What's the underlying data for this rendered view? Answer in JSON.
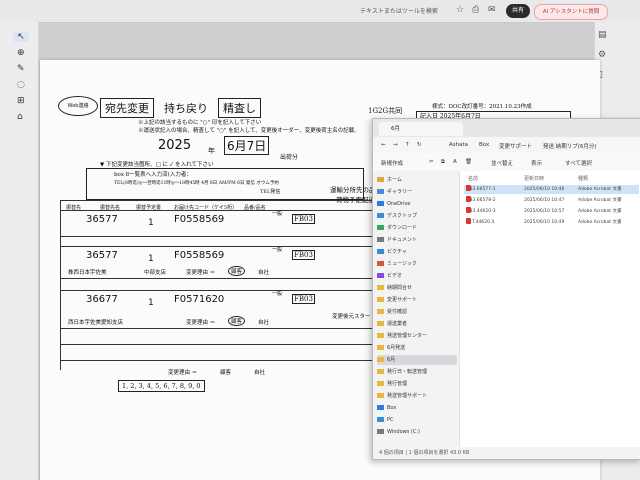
{
  "viewer": {
    "search_placeholder": "テキストまたはツールを検索",
    "share_label": "共有",
    "ai_label": "AI アシスタントに質問"
  },
  "document": {
    "stamp_text": "Web連絡",
    "tag_change": "宛先変更",
    "tag_return": "持ち戻り",
    "tag_confirm": "精査し",
    "instruction_1": "※上記の該当するものに \"○\" 印を記入して下さい",
    "instruction_2": "※運送状記入の場合、精査して \"○\" を記入して、変更後オーダー、変更後荷主名の記載、",
    "year_value": "2025",
    "year_label": "年",
    "date_value": "6月7日",
    "time_value": "出荷分",
    "code_label": "1G2G共同",
    "doc_meta_1": "様式：DOC改訂番号：2021.10.23作成",
    "doc_meta_2": "記入日 2025年6月7日",
    "fill_note": "▼ 下記変更該当箇所、□ に ✓ を入れて下さい",
    "box_label": "box 8一覧表へ入力済(入力者：",
    "tel_label": "TEL(8時迄)◎～翌時迄11時◎～18時45時 4月 8日 AM/PM 6日 発信 オウム予約",
    "tel_suffix": "TEL発信",
    "head_to": "振替先",
    "head_name": "振替先名",
    "head_plan": "振替予定書",
    "head_code": "お届け先コード（ケイ5桁）",
    "head_item": "品番/品名",
    "head_qty": "一般",
    "right_head": "運輸分所先の品番の品番で...",
    "right_head2": "荷物予定配送票",
    "rows": [
      {
        "num": "36577",
        "qty": "1",
        "code": "F0558569",
        "kind": "一般",
        "dest": "FB03"
      },
      {
        "num": "36577",
        "qty": "1",
        "code": "F0558569",
        "kind": "一般",
        "dest": "FB03"
      },
      {
        "num": "36677",
        "qty": "1",
        "code": "F0571620",
        "kind": "一般",
        "dest": "FB03"
      }
    ],
    "branch_1": "株西日本宇佐美",
    "branch_1b": "中部支店",
    "change_reason": "変更理由 ＝",
    "branch_2": "西日本宇佐美愛知支店",
    "change_reason_2": "変更理由 ＝",
    "option_1": "顧客",
    "option_2": "自社",
    "footer_change": "変更理由 ＝",
    "footer_opt": "顧客",
    "footer_opt2": "自社",
    "footer_numbers": "1, 2, 3, 4, 5, 6, 7, 8, 9, 0",
    "footer_aside": "変更後元スター"
  },
  "explorer": {
    "tab_title": "6月",
    "breadcrumb": [
      "Ashata",
      "Box",
      "変更サポート",
      "発送 納期リプ(6月分)"
    ],
    "toolbar": [
      "新規作成",
      "並べ替え",
      "表示",
      "すべて選択"
    ],
    "nav": [
      {
        "label": "ホーム",
        "color": "#e0a83a"
      },
      {
        "label": "ギャラリー",
        "color": "#4a8ad6"
      },
      {
        "label": "OneDrive",
        "color": "#2c7be5"
      },
      {
        "label": "デスクトップ",
        "color": "#3b8fd8"
      },
      {
        "label": "ダウンロード",
        "color": "#3aa26b"
      },
      {
        "label": "ドキュメント",
        "color": "#7a7a7a"
      },
      {
        "label": "ピクチャ",
        "color": "#3a88d4"
      },
      {
        "label": "ミュージック",
        "color": "#d5553f"
      },
      {
        "label": "ビデオ",
        "color": "#8a4ad6"
      },
      {
        "label": "納期問合せ",
        "color": "#e7b93e"
      },
      {
        "label": "変更サポート",
        "color": "#e7b93e"
      },
      {
        "label": "受付確認",
        "color": "#e7b93e"
      },
      {
        "label": "運送業者",
        "color": "#e7b93e"
      },
      {
        "label": "発送管理センター",
        "color": "#e7b93e"
      },
      {
        "label": "6月発送",
        "color": "#e7b93e"
      },
      {
        "label": "6月",
        "color": "#e7b93e"
      },
      {
        "label": "発行日・転送管理",
        "color": "#e7b93e"
      },
      {
        "label": "発行管理",
        "color": "#e7b93e"
      },
      {
        "label": "発送管理サポート",
        "color": "#e7b93e"
      },
      {
        "label": "Box",
        "color": "#2c7be5"
      },
      {
        "label": "PC",
        "color": "#3b8fd8"
      },
      {
        "label": "Windows (C:)",
        "color": "#7a7a7a"
      }
    ],
    "columns": [
      "名前",
      "更新日時",
      "種類"
    ],
    "files": [
      {
        "name": "T.33.66577-1",
        "date": "2025/06/10 10:46",
        "type": "Adobe Acrobat 文書"
      },
      {
        "name": "T.33.66578-2",
        "date": "2025/06/10 10:47",
        "type": "Adobe Acrobat 文書"
      },
      {
        "name": "T.33.44620-3",
        "date": "2025/06/10 10:57",
        "type": "Adobe Acrobat 文書"
      },
      {
        "name": "案 T.44620.4",
        "date": "2025/06/10 10:49",
        "type": "Adobe Acrobat 文書"
      }
    ],
    "status": "4 個の項目 | 1 個の項目を選択 43.0 KB"
  }
}
